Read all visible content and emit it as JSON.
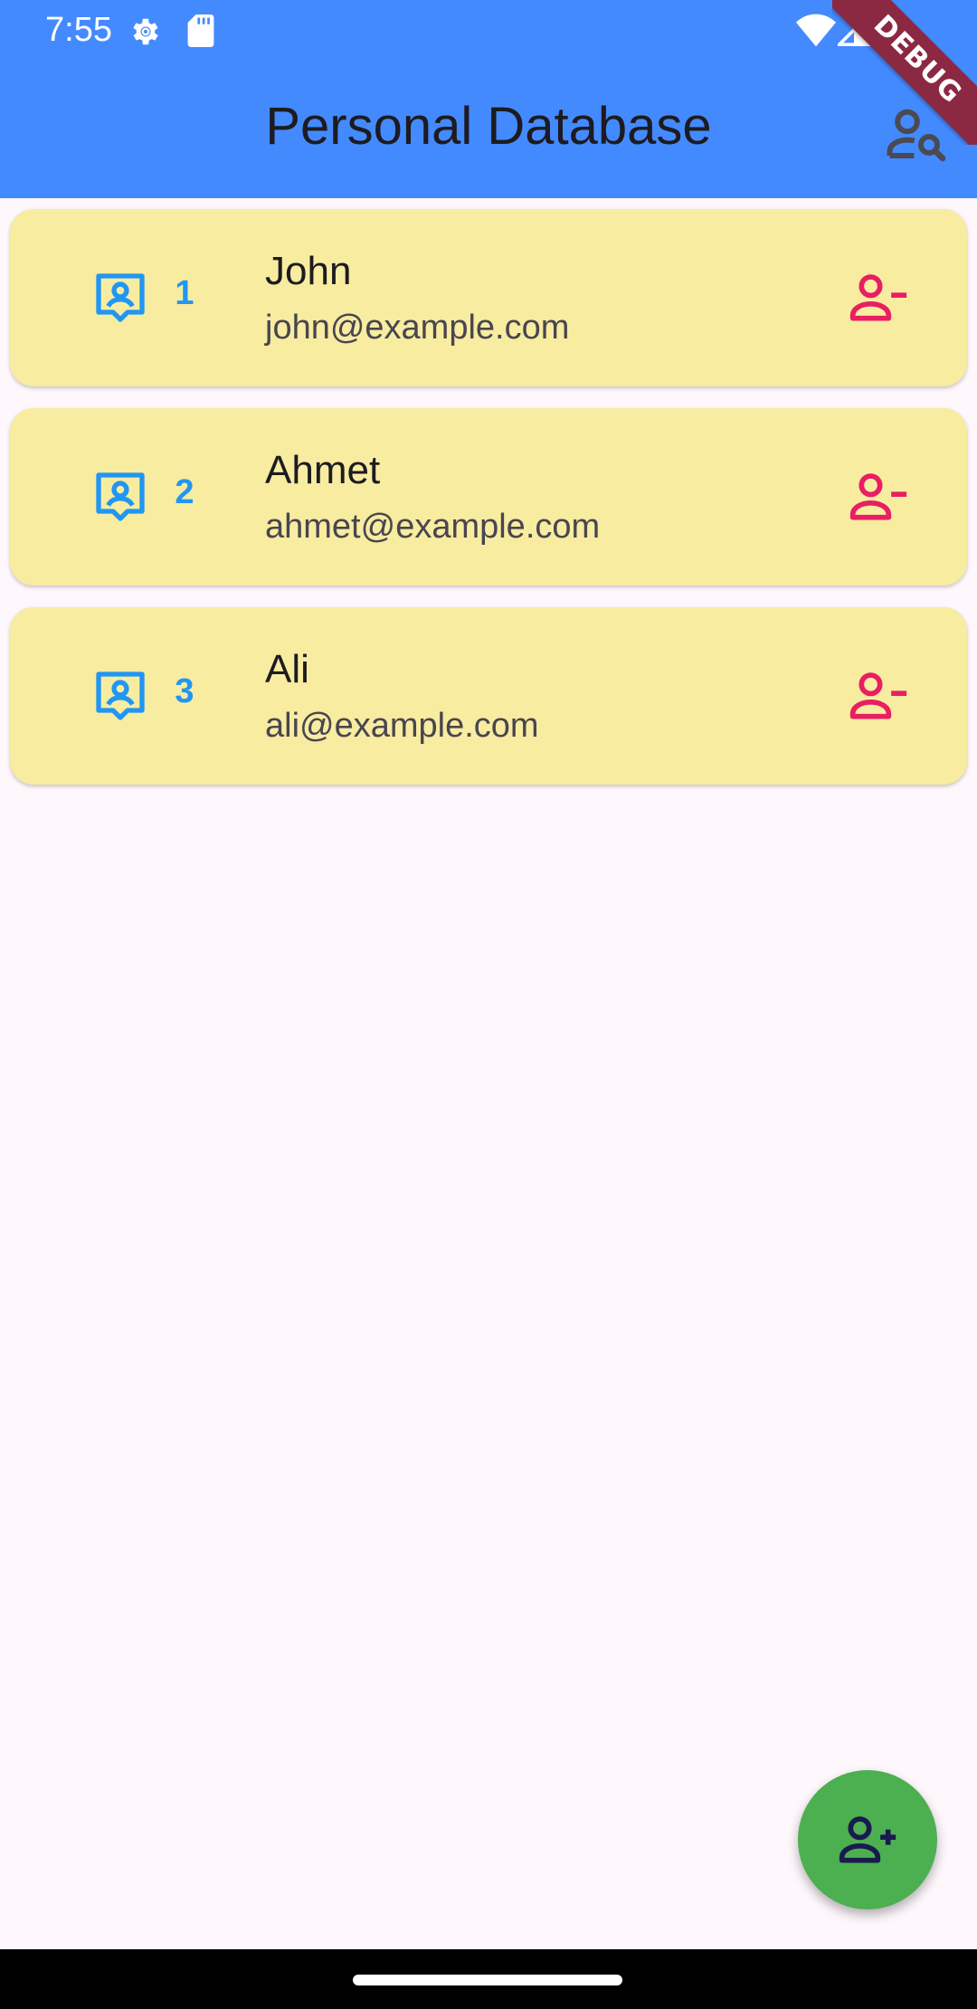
{
  "status_bar": {
    "time": "7:55"
  },
  "app_bar": {
    "title": "Personal Database",
    "debug_banner": "DEBUG"
  },
  "people": [
    {
      "id": "1",
      "name": "John",
      "email": "john@example.com"
    },
    {
      "id": "2",
      "name": "Ahmet",
      "email": "ahmet@example.com"
    },
    {
      "id": "3",
      "name": "Ali",
      "email": "ali@example.com"
    }
  ],
  "colors": {
    "app_bar": "#448aff",
    "card": "#f7eca0",
    "id_accent": "#2196f3",
    "delete": "#e91e63",
    "fab": "#4caf50"
  },
  "icons": {
    "search": "person-search-icon",
    "contact": "contact-badge-icon",
    "delete": "person-remove-icon",
    "add": "person-add-icon"
  }
}
